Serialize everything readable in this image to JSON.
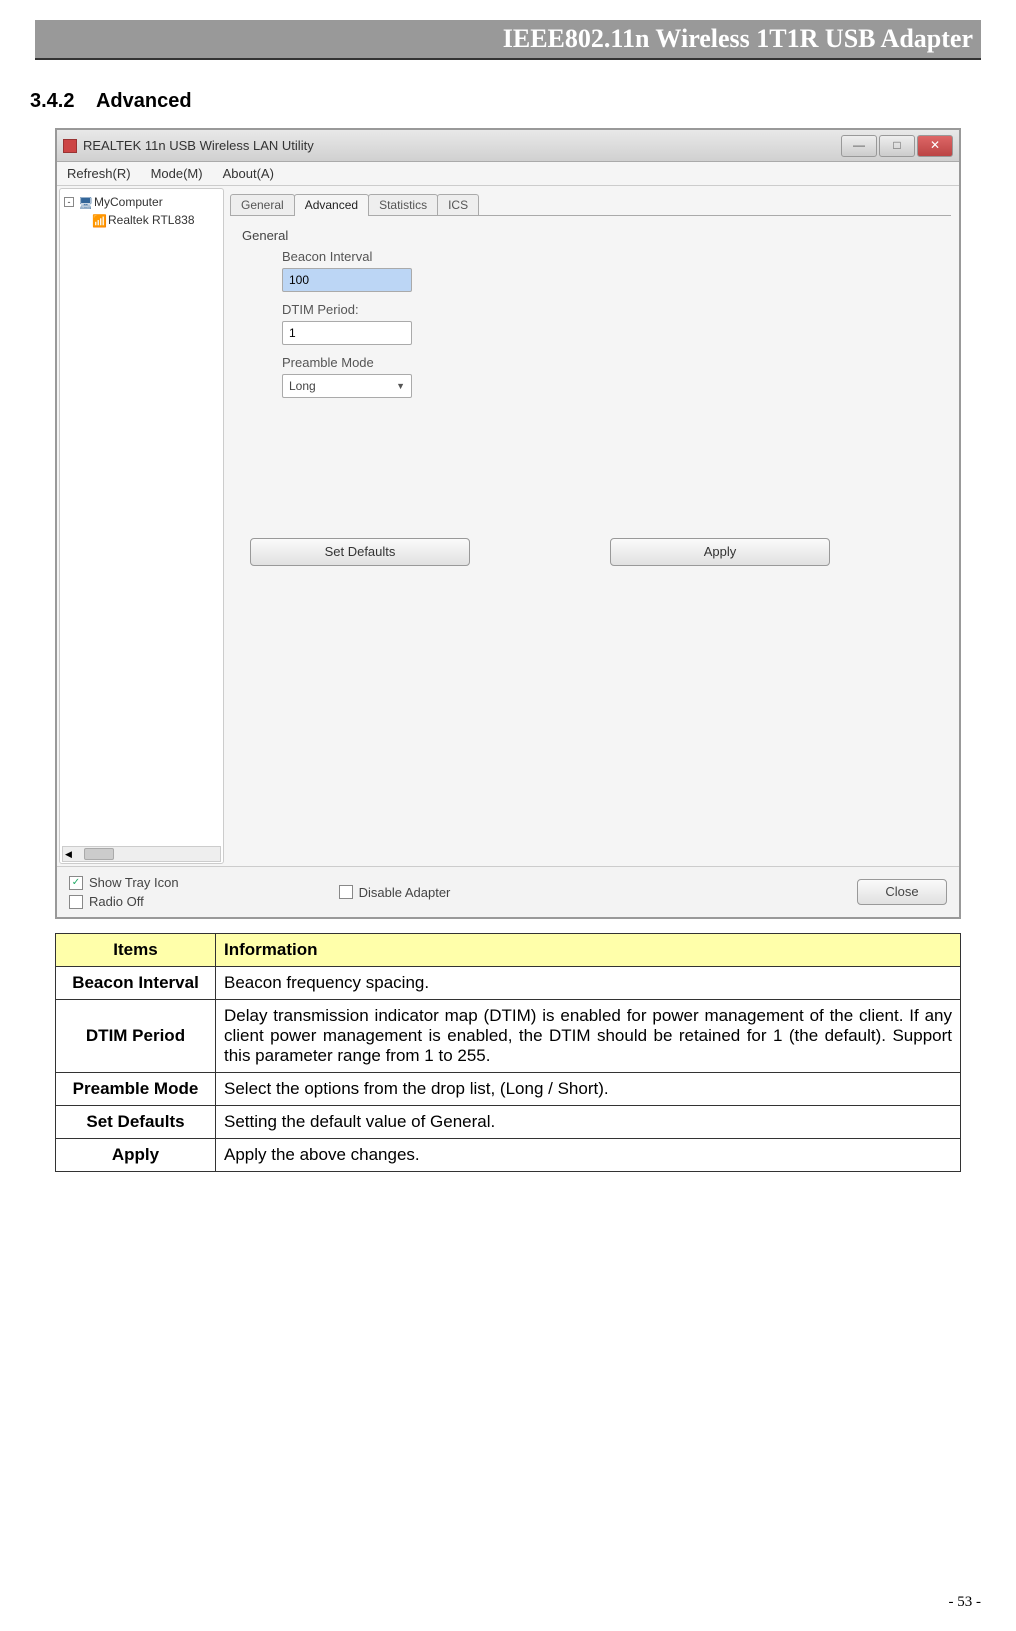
{
  "header": {
    "title": "IEEE802.11n Wireless 1T1R USB Adapter"
  },
  "section": {
    "number": "3.4.2",
    "title": "Advanced"
  },
  "window": {
    "title": "REALTEK 11n USB Wireless LAN Utility",
    "menu": {
      "refresh": "Refresh(R)",
      "mode": "Mode(M)",
      "about": "About(A)"
    },
    "tree": {
      "root": "MyComputer",
      "child": "Realtek RTL838"
    },
    "tabs": {
      "general": "General",
      "advanced": "Advanced",
      "statistics": "Statistics",
      "ics": "ICS"
    },
    "form": {
      "group": "General",
      "beacon_label": "Beacon Interval",
      "beacon_value": "100",
      "dtim_label": "DTIM Period:",
      "dtim_value": "1",
      "preamble_label": "Preamble Mode",
      "preamble_value": "Long"
    },
    "buttons": {
      "set_defaults": "Set Defaults",
      "apply": "Apply"
    },
    "bottom": {
      "show_tray": "Show Tray Icon",
      "radio_off": "Radio Off",
      "disable_adapter": "Disable Adapter",
      "close": "Close"
    }
  },
  "table": {
    "header_items": "Items",
    "header_info": "Information",
    "rows": [
      {
        "item": "Beacon Interval",
        "info": "Beacon frequency spacing."
      },
      {
        "item": "DTIM Period",
        "info": "Delay transmission indicator map (DTIM) is enabled for power management of the client. If any client power management is enabled, the DTIM should be retained for 1 (the default). Support this parameter range from 1 to 255."
      },
      {
        "item": "Preamble Mode",
        "info": "Select the options from the drop list, (Long / Short)."
      },
      {
        "item": "Set Defaults",
        "info": "Setting the default value of General."
      },
      {
        "item": "Apply",
        "info": "Apply the above changes."
      }
    ]
  },
  "page": {
    "number": "- 53 -"
  }
}
